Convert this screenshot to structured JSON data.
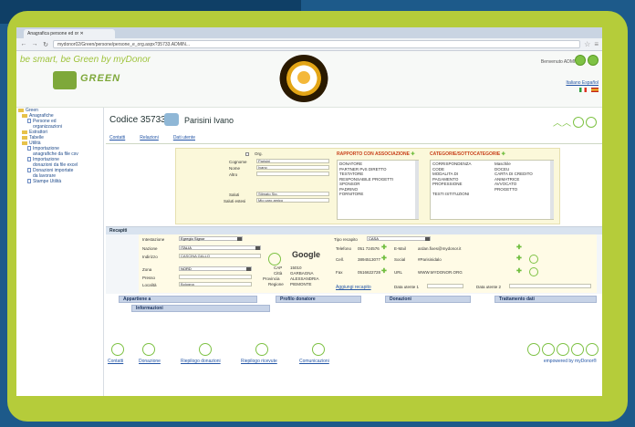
{
  "browser": {
    "tab_title": "Anagrafica persone ed or",
    "url": "mydonor02/Green/persone/persone_e_org.aspx?35733.ADMIN..."
  },
  "header": {
    "tagline": "be smart, be Green by myDonor",
    "logo_text": "GREEN",
    "welcome": "Benvenuto ADMIN",
    "languages": "Italiano Español"
  },
  "sidebar": {
    "items": [
      {
        "label": "Green",
        "type": "folder",
        "level": 0
      },
      {
        "label": "Anagrafiche",
        "type": "folder",
        "level": 1
      },
      {
        "label": "Persone ed",
        "type": "doc",
        "level": 2
      },
      {
        "label": "organizzazioni",
        "type": "none",
        "level": 2
      },
      {
        "label": "Estrattori",
        "type": "folder",
        "level": 1
      },
      {
        "label": "Tabelle",
        "type": "folder",
        "level": 1
      },
      {
        "label": "Utilità",
        "type": "folder",
        "level": 1
      },
      {
        "label": "Importazione",
        "type": "doc",
        "level": 2
      },
      {
        "label": "anagrafiche da file csv",
        "type": "none",
        "level": 2
      },
      {
        "label": "Importazione",
        "type": "doc",
        "level": 2
      },
      {
        "label": "donazioni da file excel",
        "type": "none",
        "level": 2
      },
      {
        "label": "Donazioni importate",
        "type": "doc",
        "level": 2
      },
      {
        "label": "da lavorare",
        "type": "none",
        "level": 2
      },
      {
        "label": "Stampe Utilità",
        "type": "doc",
        "level": 2
      }
    ]
  },
  "main": {
    "codice": "Codice 35733",
    "name": "Parisini Ivano",
    "subnav": [
      "Contatti",
      "Relazioni",
      "Dati utente"
    ]
  },
  "upper": {
    "org_label": "Org.",
    "fields": [
      {
        "label": "Cognome",
        "value": "Parisini"
      },
      {
        "label": "Nome",
        "value": "Ivano"
      },
      {
        "label": "Altro",
        "value": ""
      },
      {
        "label": "Saluti",
        "value": "Stimato Sig."
      },
      {
        "label": "Saluti estesi",
        "value": "Mio caro amico"
      }
    ],
    "rapporto_title": "RAPPORTO CON ASSOCIAZIONE",
    "rapporto_items": [
      "DONATORE",
      "PARTNER PvS DIRETTO",
      "TESTATORE",
      "RESPONSABILE PROGETTI",
      "SPONSOR",
      "PADRINO",
      "FORNITORE"
    ],
    "categorie_title": "CATEGORIE/SOTTOCATEGORIE",
    "categorie_left": [
      "CORRISPONDENZA",
      "CODE",
      "MODALITA DI",
      "PAGAMENTO",
      "PROFESSIONE",
      "",
      "TESTI ISTITUZIONI"
    ],
    "categorie_right": [
      "Maschile",
      "DOCEU",
      "CARTA DI CREDITO",
      "ANIMATRICE",
      "AVVOCATO",
      "PROGETTO"
    ]
  },
  "recapiti": {
    "title": "Recapiti",
    "intestazione_label": "Intestazione",
    "intestazione_value": "Egregio Signor",
    "nazione_label": "Nazione",
    "nazione_value": "ITALIA",
    "indirizzo_label": "Indirizzo",
    "indirizzo_value": "CASCINA GALLO",
    "zona_label": "Zona",
    "zona_value": "NORD",
    "presso_label": "Presso",
    "localita_label": "Località",
    "localita_value": "Bologna",
    "google_label": "Google",
    "cap_label": "CAP",
    "cap_value": "15010",
    "citta_label": "Città",
    "citta_value": "GARBAGNA",
    "provincia_label": "Provincia",
    "provincia_value": "ALESSANDRIA",
    "regione_label": "Regione",
    "regione_value": "PIEMONTE",
    "tipo_label": "Tipo recapito",
    "tipo_value": "CASA",
    "telefono_label": "Telefono",
    "telefono_value": "051 724576",
    "cell_label": "Cell.",
    "cell_value": "3894513077",
    "fax_label": "Fax",
    "fax_value": "0516622728",
    "email_label": "E-Mail",
    "email_value": "ardan.fixes@mydonor.it",
    "social_label": "Social",
    "social_value": "#Parisinidalo",
    "url_label": "URL",
    "url_value": "WWW.MYDONOR.ORG",
    "aggiungi": "Aggiungi recapito",
    "data_utente1": "Data utente 1",
    "data_utente2": "Data utente 2"
  },
  "filters": {
    "row1": [
      "Appartiene a",
      "Profilo donatore",
      "Donazioni",
      "Trattamento dati"
    ],
    "row2": [
      "Informazioni"
    ]
  },
  "footer": {
    "actions": [
      "Contatti",
      "Donazione",
      "Riepilogo donazioni",
      "Riepilogo ricevute",
      "Comunicazioni"
    ],
    "powered": "empowered by myDonor®"
  }
}
